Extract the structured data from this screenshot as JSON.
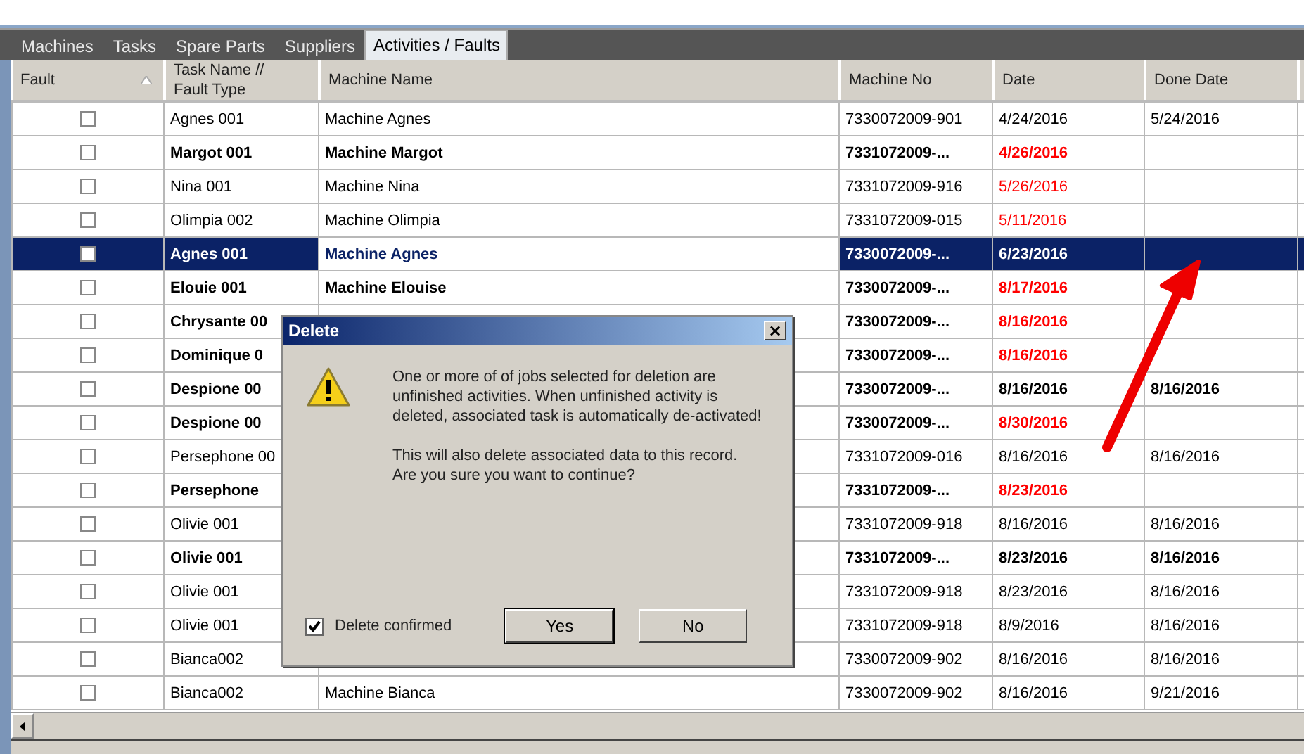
{
  "tabs": [
    {
      "label": "Machines",
      "selected": false
    },
    {
      "label": "Tasks",
      "selected": false
    },
    {
      "label": "Spare Parts",
      "selected": false
    },
    {
      "label": "Suppliers",
      "selected": false
    },
    {
      "label": "Activities / Faults",
      "selected": true
    }
  ],
  "table": {
    "columns": [
      {
        "label": "Fault",
        "sorted": true
      },
      {
        "label": "Task Name //\nFault Type"
      },
      {
        "label": "Machine Name"
      },
      {
        "label": "Machine No"
      },
      {
        "label": "Date"
      },
      {
        "label": "Done Date"
      }
    ],
    "rows": [
      {
        "fault": false,
        "task": "Agnes 001",
        "machine_name": "Machine Agnes",
        "machine_no": "7330072009-901",
        "date": "4/24/2016",
        "done_date": "5/24/2016",
        "bold": false,
        "overdue": false,
        "selected": false
      },
      {
        "fault": false,
        "task": "Margot 001",
        "machine_name": "Machine Margot",
        "machine_no": "7331072009-...",
        "date": "4/26/2016",
        "bold": true,
        "overdue": true,
        "selected": false
      },
      {
        "fault": false,
        "task": "Nina 001",
        "machine_name": "Machine Nina",
        "machine_no": "7331072009-916",
        "date": "5/26/2016",
        "bold": false,
        "overdue": true,
        "selected": false
      },
      {
        "fault": false,
        "task": "Olimpia 002",
        "machine_name": "Machine Olimpia",
        "machine_no": "7331072009-015",
        "date": "5/11/2016",
        "bold": false,
        "overdue": true,
        "selected": false
      },
      {
        "fault": false,
        "task": "Agnes 001",
        "machine_name": "Machine Agnes",
        "machine_no": "7330072009-...",
        "date": "6/23/2016",
        "bold": true,
        "overdue": false,
        "selected": true
      },
      {
        "fault": false,
        "task": "Elouie 001",
        "machine_name": "Machine Elouise",
        "machine_no": "7330072009-...",
        "date": "8/17/2016",
        "bold": true,
        "overdue": true,
        "selected": false
      },
      {
        "fault": false,
        "task": "Chrysante 00",
        "machine_no": "7330072009-...",
        "date": "8/16/2016",
        "bold": true,
        "overdue": true,
        "selected": false
      },
      {
        "fault": false,
        "task": "Dominique 0",
        "machine_no": "7330072009-...",
        "date": "8/16/2016",
        "bold": true,
        "overdue": true,
        "selected": false
      },
      {
        "fault": false,
        "task": "Despione 00",
        "machine_no": "7330072009-...",
        "date": "8/16/2016",
        "done_date": "8/16/2016",
        "bold": true,
        "overdue": false,
        "selected": false
      },
      {
        "fault": false,
        "task": "Despione 00",
        "machine_no": "7330072009-...",
        "date": "8/30/2016",
        "bold": true,
        "overdue": true,
        "selected": false
      },
      {
        "fault": false,
        "task": "Persephone 00",
        "machine_no": "7331072009-016",
        "date": "8/16/2016",
        "done_date": "8/16/2016",
        "bold": false,
        "overdue": false,
        "selected": false
      },
      {
        "fault": false,
        "task": "Persephone",
        "machine_no": "7331072009-...",
        "date": "8/23/2016",
        "bold": true,
        "overdue": true,
        "selected": false
      },
      {
        "fault": false,
        "task": "Olivie 001",
        "machine_no": "7331072009-918",
        "date": "8/16/2016",
        "done_date": "8/16/2016",
        "bold": false,
        "overdue": false,
        "selected": false
      },
      {
        "fault": false,
        "task": "Olivie 001",
        "machine_no": "7331072009-...",
        "date": "8/23/2016",
        "done_date": "8/16/2016",
        "bold": true,
        "overdue": false,
        "selected": false
      },
      {
        "fault": false,
        "task": "Olivie 001",
        "machine_no": "7331072009-918",
        "date": "8/23/2016",
        "done_date": "8/16/2016",
        "bold": false,
        "overdue": false,
        "selected": false
      },
      {
        "fault": false,
        "task": "Olivie 001",
        "machine_no": "7331072009-918",
        "date": "8/9/2016",
        "done_date": "8/16/2016",
        "bold": false,
        "overdue": false,
        "selected": false
      },
      {
        "fault": false,
        "task": "Bianca002",
        "machine_no": "7330072009-902",
        "date": "8/16/2016",
        "done_date": "8/16/2016",
        "bold": false,
        "overdue": false,
        "selected": false
      },
      {
        "fault": false,
        "task": "Bianca002",
        "machine_name": "Machine Bianca",
        "machine_no": "7330072009-902",
        "date": "8/16/2016",
        "done_date": "9/21/2016",
        "bold": false,
        "overdue": false,
        "selected": false
      }
    ]
  },
  "dialog": {
    "title": "Delete",
    "close": "×",
    "message": "One or more of of jobs selected for deletion are unfinished activities. When unfinished activity is deleted, associated task is automatically de-activated!",
    "question": "This will also delete associated data to this record.\n Are you sure you want to continue?",
    "confirm": {
      "label": "Delete confirmed",
      "checked": true
    },
    "buttons": [
      "Yes",
      "No"
    ]
  }
}
